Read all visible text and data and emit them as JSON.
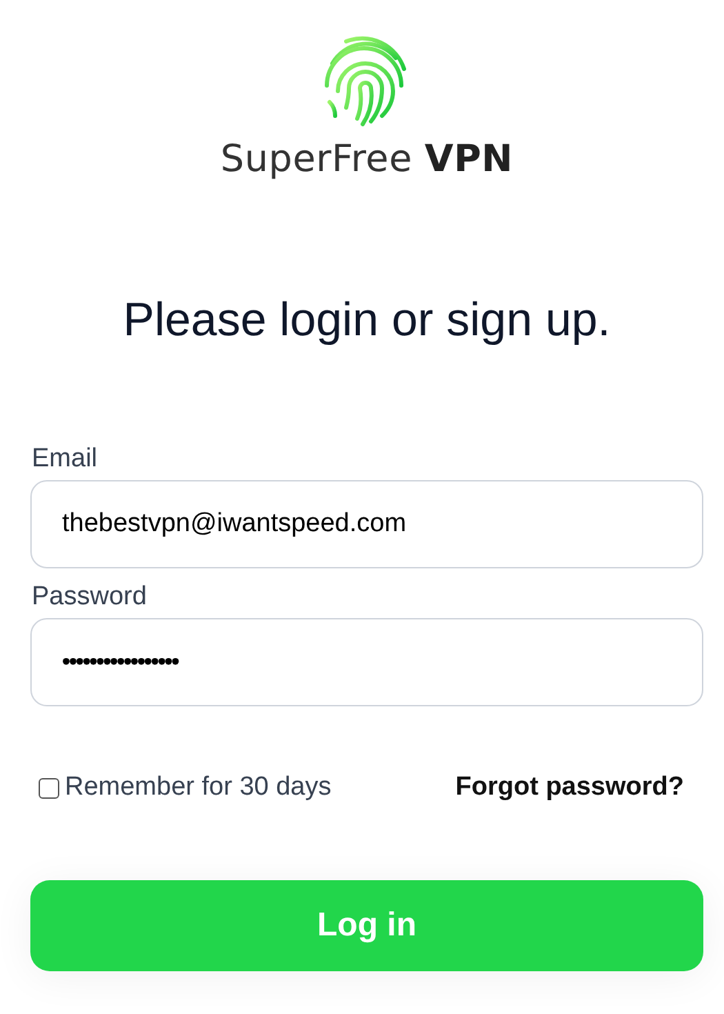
{
  "brand": {
    "name": "SuperFree **VPN**"
  },
  "heading": "Please login or sign up.",
  "fields": [
    {
      "label": "Email",
      "value": "thebestvpn@iwantspeed.com",
      "kind": "text"
    },
    {
      "label": "Password",
      "value": "•••••••••••••••••",
      "kind": "password"
    }
  ],
  "remember": {
    "label": "Remember for 30 days",
    "checked": false
  },
  "forgot_link": "Forgot password?",
  "login_button": "Log in"
}
